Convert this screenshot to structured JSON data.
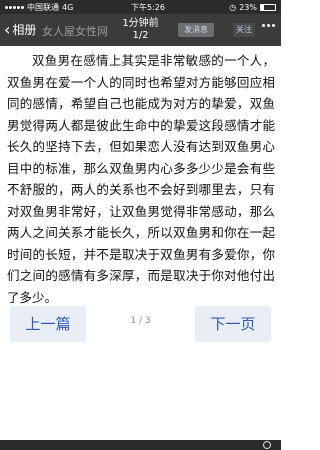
{
  "status_bar": {
    "carrier": "中国联通",
    "network": "4G",
    "time": "下午5:26",
    "battery_percent": "23%",
    "battery_level": 0.23
  },
  "nav": {
    "back_label": "相册",
    "site_name": "女人屋女性网",
    "title": "1分钟前",
    "page_indicator": "1/2",
    "post_button": "发消息",
    "follow_button": "关注"
  },
  "article": {
    "body": "双鱼男在感情上其实是非常敏感的一个人，双鱼男在爱一个人的同时也希望对方能够回应相同的感情，希望自己也能成为对方的挚爱，双鱼男觉得两人都是彼此生命中的挚爱这段感情才能长久的坚持下去，但如果恋人没有达到双鱼男心目中的标准，那么双鱼男内心多多少少是会有些不舒服的，两人的关系也不会好到哪里去，只有对双鱼男非常好，让双鱼男觉得非常感动，那么两人之间关系才能长久，所以双鱼男和你在一起时间的长短，并不是取决于双鱼男有多爱你，你们之间的感情有多深厚，而是取决于你对他付出了多少。"
  },
  "pager": {
    "prev_label": "上一篇",
    "next_label": "下一页",
    "page_count": "1 / 3"
  },
  "icons": {
    "back": "chevron-left-icon",
    "more": "more-dots-icon",
    "search": "search-icon"
  }
}
